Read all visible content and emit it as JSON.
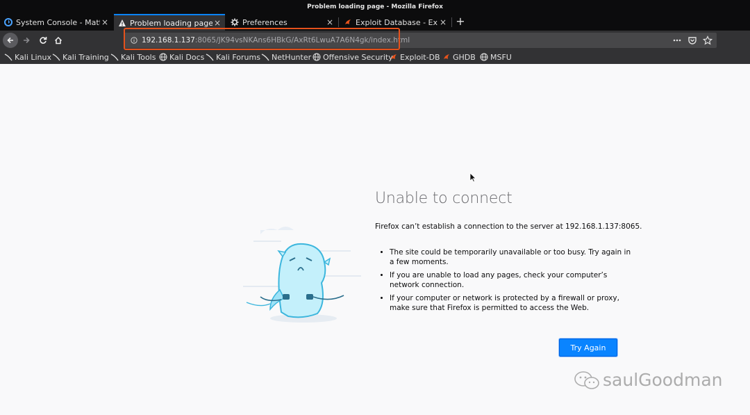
{
  "window": {
    "title": "Problem loading page - Mozilla Firefox"
  },
  "tabs": [
    {
      "label": "System Console - Matte",
      "icon": "mattermost-icon",
      "active": false
    },
    {
      "label": "Problem loading page",
      "icon": "warning-icon",
      "active": true
    },
    {
      "label": "Preferences",
      "icon": "gear-icon",
      "active": false
    },
    {
      "label": "Exploit Database - Explo",
      "icon": "exploitdb-icon",
      "active": false
    }
  ],
  "tab_close_glyph": "×",
  "new_tab_glyph": "+",
  "urlbar": {
    "host": "192.168.1.137",
    "rest": ":8065/JK94vsNKAns6HBkG/AxRt6LwuA7A6N4gk/index.html",
    "actions": [
      "more-icon",
      "pocket-icon",
      "bookmark-star-icon"
    ]
  },
  "bookmarks": [
    {
      "label": "Kali Linux",
      "icon": "kali-dragon-icon"
    },
    {
      "label": "Kali Training",
      "icon": "kali-dragon-icon"
    },
    {
      "label": "Kali Tools",
      "icon": "kali-dragon-icon"
    },
    {
      "label": "Kali Docs",
      "icon": "globe-icon"
    },
    {
      "label": "Kali Forums",
      "icon": "kali-dragon-icon"
    },
    {
      "label": "NetHunter",
      "icon": "kali-dragon-icon"
    },
    {
      "label": "Offensive Security",
      "icon": "globe-icon"
    },
    {
      "label": "Exploit-DB",
      "icon": "exploitdb-icon"
    },
    {
      "label": "GHDB",
      "icon": "exploitdb-icon"
    },
    {
      "label": "MSFU",
      "icon": "globe-icon"
    }
  ],
  "error": {
    "title": "Unable to connect",
    "description": "Firefox can’t establish a connection to the server at 192.168.1.137:8065.",
    "bullets": [
      "The site could be temporarily unavailable or too busy. Try again in a few moments.",
      "If you are unable to load any pages, check your computer’s network connection.",
      "If your computer or network is protected by a firewall or proxy, make sure that Firefox is permitted to access the Web."
    ],
    "button": "Try Again"
  },
  "watermark": {
    "text": "saulGoodman"
  },
  "colors": {
    "accent": "#0a84ff",
    "highlight": "#e5521c",
    "chrome_dark": "#0c0c0d",
    "toolbar": "#323234"
  }
}
